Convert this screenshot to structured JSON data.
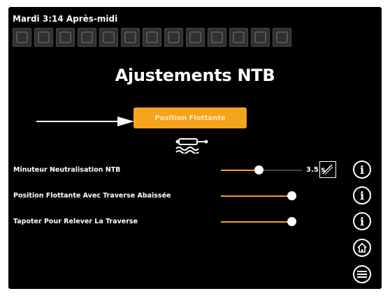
{
  "header": {
    "datetime": "Mardi 3:14 Après-midi"
  },
  "toolbar": {
    "icons": [
      "nav-icon-1",
      "nav-icon-2",
      "nav-icon-3",
      "nav-icon-4",
      "nav-icon-5",
      "nav-icon-6",
      "nav-icon-7",
      "nav-icon-8",
      "nav-icon-9",
      "nav-icon-10",
      "nav-icon-11",
      "nav-icon-12",
      "nav-icon-13"
    ]
  },
  "page": {
    "title": "Ajustements NTB"
  },
  "float_button": {
    "label": "Position Flottante"
  },
  "settings": [
    {
      "label": "Minuteur Neutralisation NTB",
      "value": "3.5 s",
      "level": 0.5
    },
    {
      "label": "Position Flottante Avec Traverse Abaissée",
      "level": 1.0
    },
    {
      "label": "Tapoter Pour Relever La Traverse",
      "level": 1.0
    }
  ],
  "colors": {
    "accent": "#f4a31c",
    "background": "#000000",
    "text": "#ffffff"
  },
  "side_icons": [
    "info-icon",
    "info-icon",
    "info-icon",
    "home-icon",
    "menu-icon"
  ]
}
